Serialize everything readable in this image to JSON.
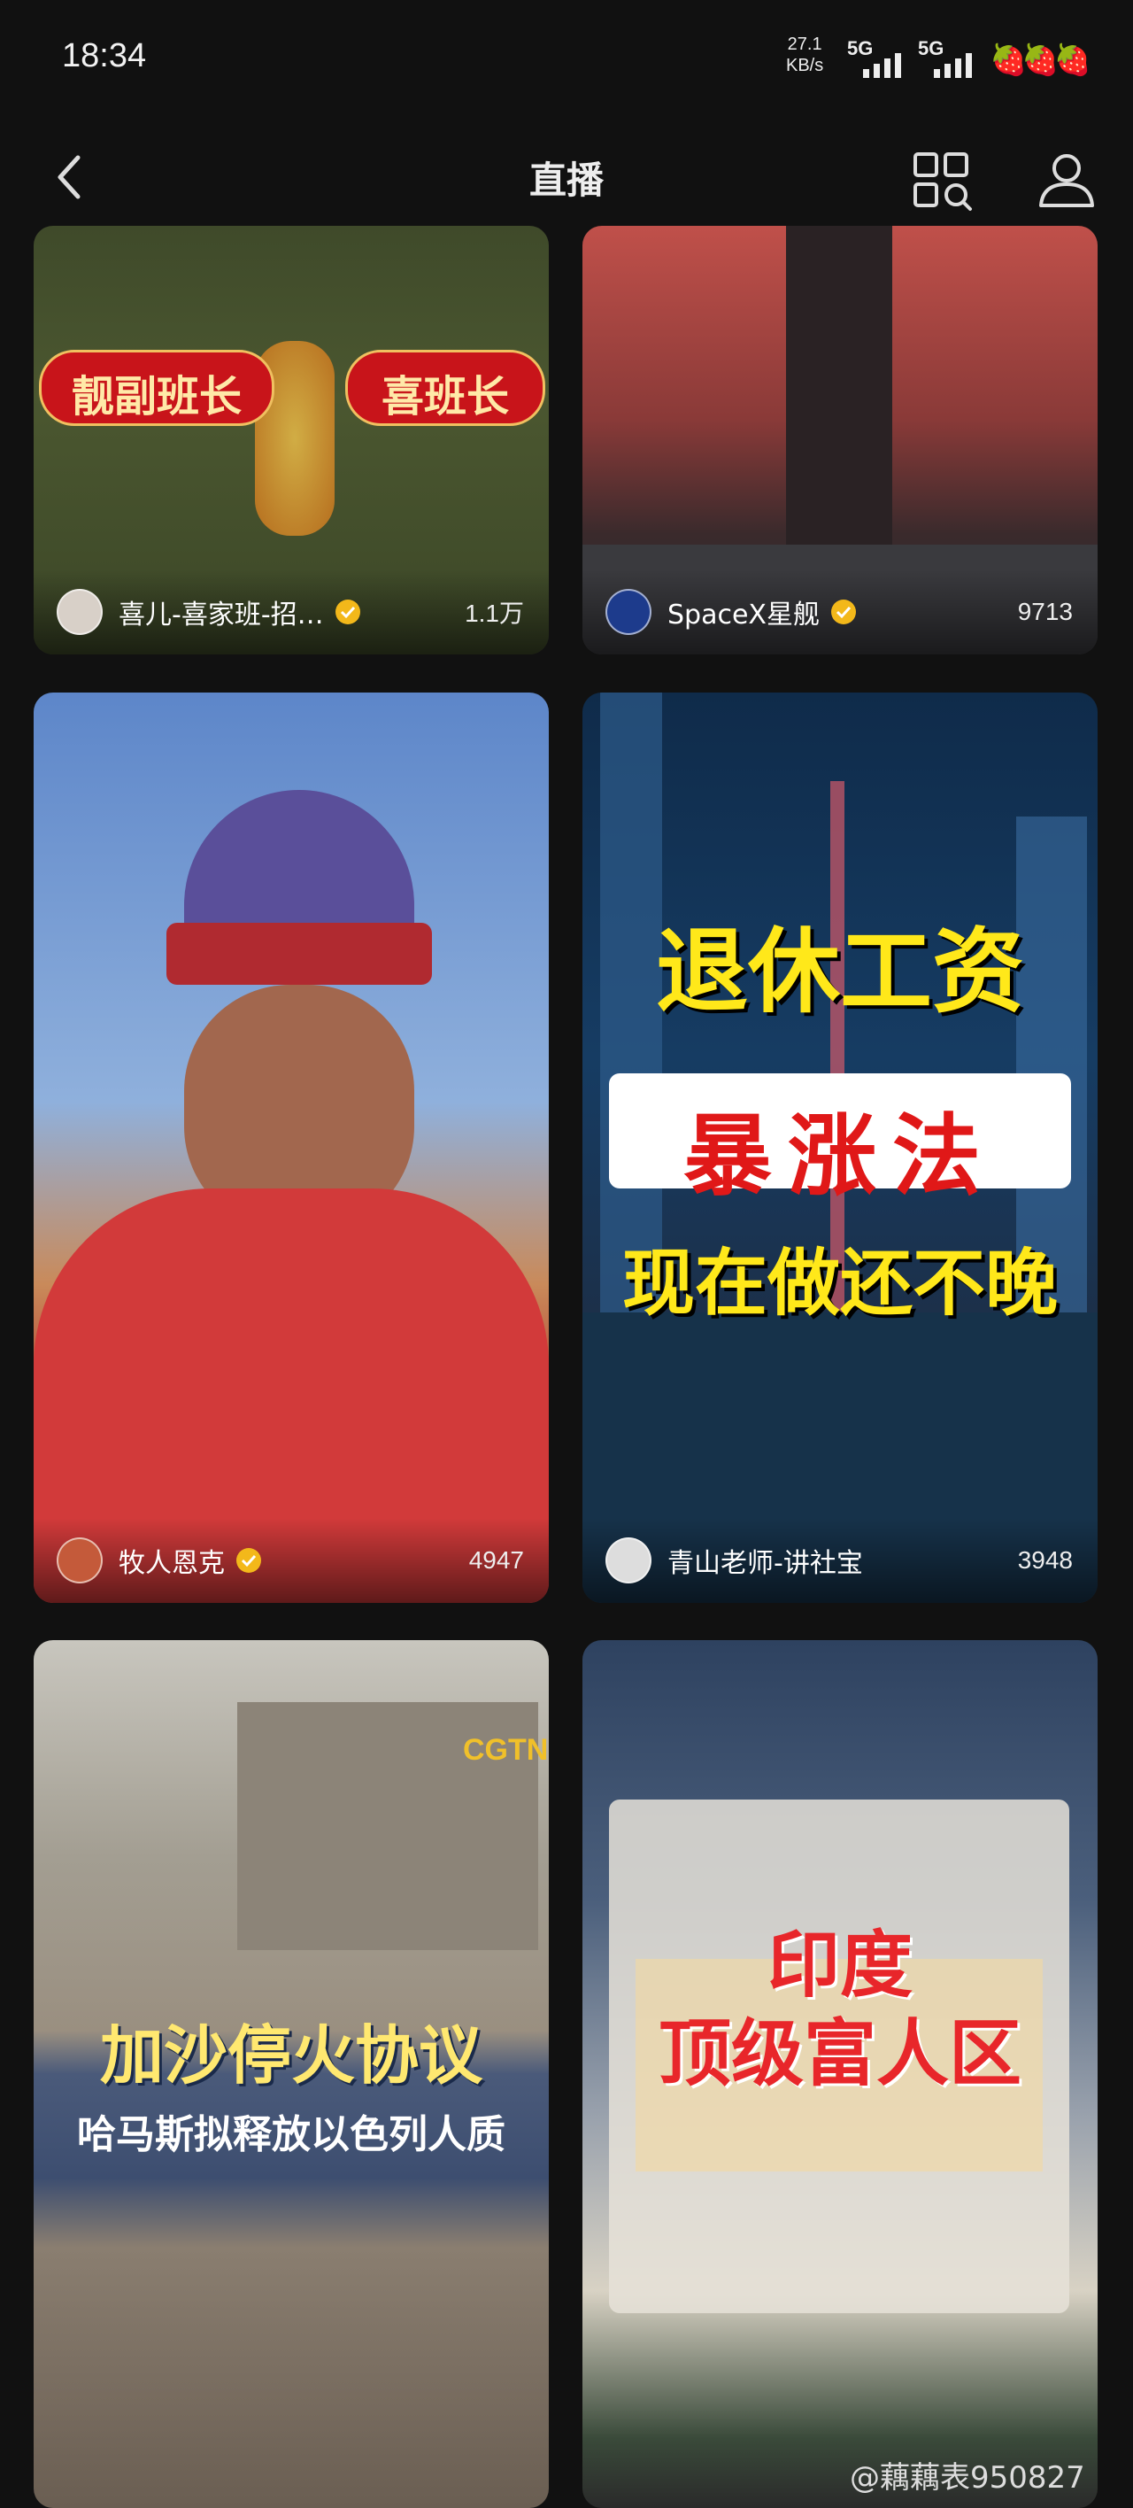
{
  "status": {
    "time": "18:34",
    "speed": "27.1",
    "speed_unit": "KB/s",
    "net1": "5G",
    "net2": "5G",
    "battery_icon": "strawberry-icons"
  },
  "nav": {
    "title": "直播",
    "back_icon": "chevron-left-icon",
    "scan_icon": "scan-search-icon",
    "user_icon": "user-icon"
  },
  "cards": [
    {
      "name": "喜儿-喜家班-招…",
      "count": "1.1万",
      "overlay": [
        "靓副班长",
        "喜班长"
      ]
    },
    {
      "name": "SpaceX星舰",
      "count": "9713"
    },
    {
      "name": "牧人恩克",
      "count": "4947"
    },
    {
      "name": "青山老师-讲社宝",
      "count": "3948",
      "overlay": [
        "退休工资",
        "暴涨法",
        "现在做还不晚"
      ]
    },
    {
      "overlay": [
        "CGTN",
        "加沙停火协议",
        "哈马斯拟释放以色列人质"
      ]
    },
    {
      "overlay": [
        "印度",
        "顶级富人区"
      ]
    }
  ],
  "watermark": "@藕藕表950827"
}
